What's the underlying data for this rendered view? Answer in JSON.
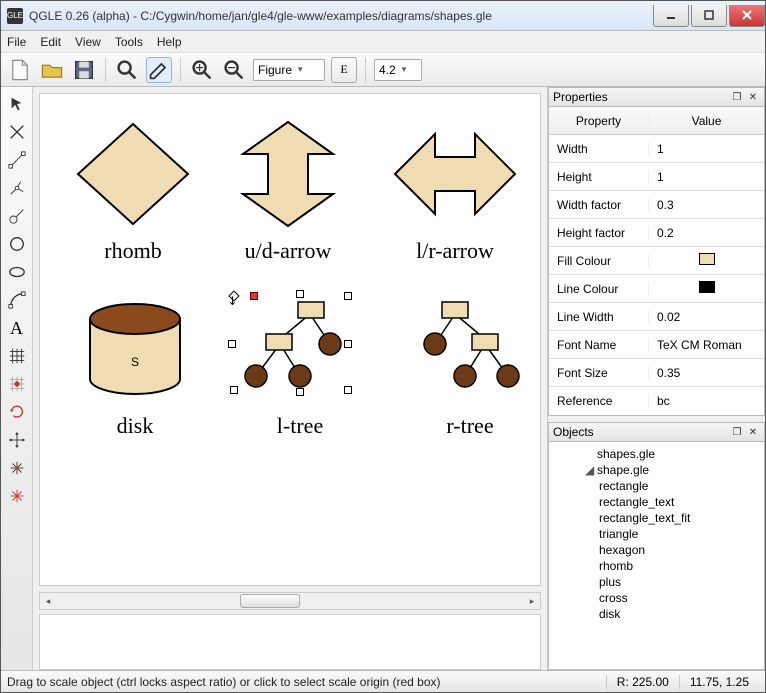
{
  "window": {
    "app_badge": "GLE",
    "title": "QGLE 0.26 (alpha) - C:/Cygwin/home/jan/gle4/gle-www/examples/diagrams/shapes.gle"
  },
  "menu": {
    "items": [
      "File",
      "Edit",
      "View",
      "Tools",
      "Help"
    ]
  },
  "toolbar": {
    "figure_label": "Figure",
    "e_label": "E",
    "zoom_label": "4.2"
  },
  "shapes": {
    "rhomb": "rhomb",
    "udarrow": "u/d-arrow",
    "lrarrow": "l/r-arrow",
    "disk": "disk",
    "disk_letter": "S",
    "ltree": "l-tree",
    "rtree": "r-tree"
  },
  "colors": {
    "fill": "#efdcb3",
    "dark": "#6b3a17",
    "line": "#000000"
  },
  "properties": {
    "header_property": "Property",
    "header_value": "Value",
    "rows": [
      {
        "k": "Width",
        "v": "1"
      },
      {
        "k": "Height",
        "v": "1"
      },
      {
        "k": "Width factor",
        "v": "0.3"
      },
      {
        "k": "Height factor",
        "v": "0.2"
      },
      {
        "k": "Fill Colour",
        "v": "__FILL__"
      },
      {
        "k": "Line Colour",
        "v": "__LINE__"
      },
      {
        "k": "Line Width",
        "v": "0.02"
      },
      {
        "k": "Font Name",
        "v": "TeX CM Roman"
      },
      {
        "k": "Font Size",
        "v": "0.35"
      },
      {
        "k": "Reference",
        "v": "bc"
      }
    ]
  },
  "panels": {
    "properties_title": "Properties",
    "objects_title": "Objects"
  },
  "objects": {
    "root": "shapes.gle",
    "group": "shape.gle",
    "items": [
      "rectangle",
      "rectangle_text",
      "rectangle_text_fit",
      "triangle",
      "hexagon",
      "rhomb",
      "plus",
      "cross",
      "disk"
    ]
  },
  "status": {
    "msg": "Drag to scale object (ctrl locks aspect ratio) or click to select scale origin (red box)",
    "r": "R:  225.00",
    "coords": "11.75, 1.25"
  }
}
